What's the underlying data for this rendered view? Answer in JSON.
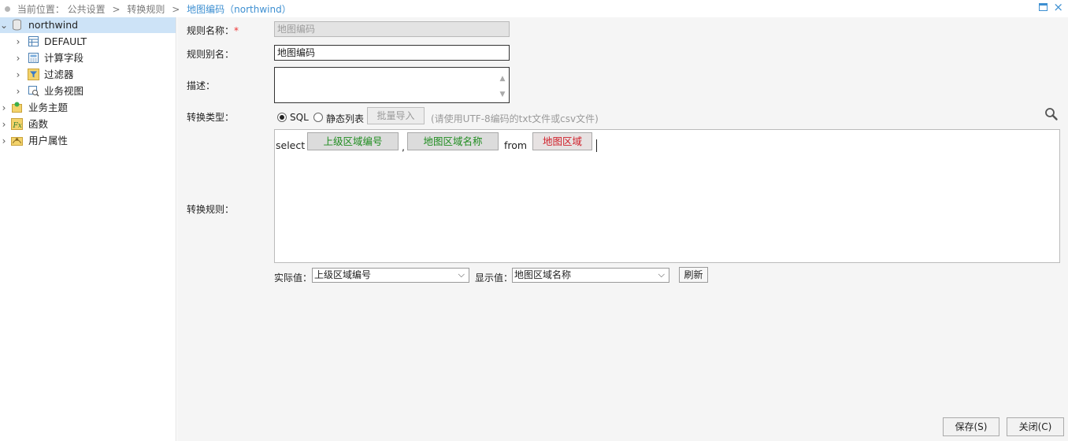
{
  "breadcrumb": {
    "prefix": "当前位置：",
    "items": [
      "公共设置",
      "转换规则"
    ],
    "separator": ">",
    "current": "地图编码（northwind）"
  },
  "window_controls": {
    "maximize_icon": "maximize-icon",
    "close_glyph": "×"
  },
  "tree": {
    "root": {
      "label": "northwind",
      "expanded": true,
      "selected": true,
      "icon": "database-icon"
    },
    "children": [
      {
        "label": "DEFAULT",
        "icon": "table-icon"
      },
      {
        "label": "计算字段",
        "icon": "calc-field-icon"
      },
      {
        "label": "过滤器",
        "icon": "filter-icon"
      },
      {
        "label": "业务视图",
        "icon": "business-view-icon"
      }
    ],
    "siblings": [
      {
        "label": "业务主题",
        "icon": "business-theme-icon"
      },
      {
        "label": "函数",
        "icon": "function-icon"
      },
      {
        "label": "用户属性",
        "icon": "user-attribute-icon"
      }
    ]
  },
  "form": {
    "rule_name_label": "规则名称：",
    "required_mark": "*",
    "rule_name_value": "地图编码",
    "rule_alias_label": "规则别名：",
    "rule_alias_value": "地图编码",
    "description_label": "描述：",
    "description_value": "",
    "convert_type_label": "转换类型：",
    "option_sql": "SQL",
    "option_static": "静态列表",
    "batch_import": "批量导入",
    "hint": "(请使用UTF-8编码的txt文件或csv文件)",
    "convert_rule_label": "转换规则：",
    "sql": {
      "select_kw": "select",
      "field1": "上级区域编号",
      "comma": ",",
      "field2": "地图区域名称",
      "from_kw": "from",
      "table": "地图区域"
    },
    "actual_value_label": "实际值：",
    "actual_value": "上级区域编号",
    "display_value_label": "显示值：",
    "display_value": "地图区域名称",
    "refresh": "刷新"
  },
  "footer": {
    "save": "保存(S)",
    "close": "关闭(C)"
  },
  "colors": {
    "accent": "#3d8fd1",
    "selected_row": "#cde3f7",
    "field_green": "#1e8c1e",
    "field_red": "#d0202a"
  }
}
